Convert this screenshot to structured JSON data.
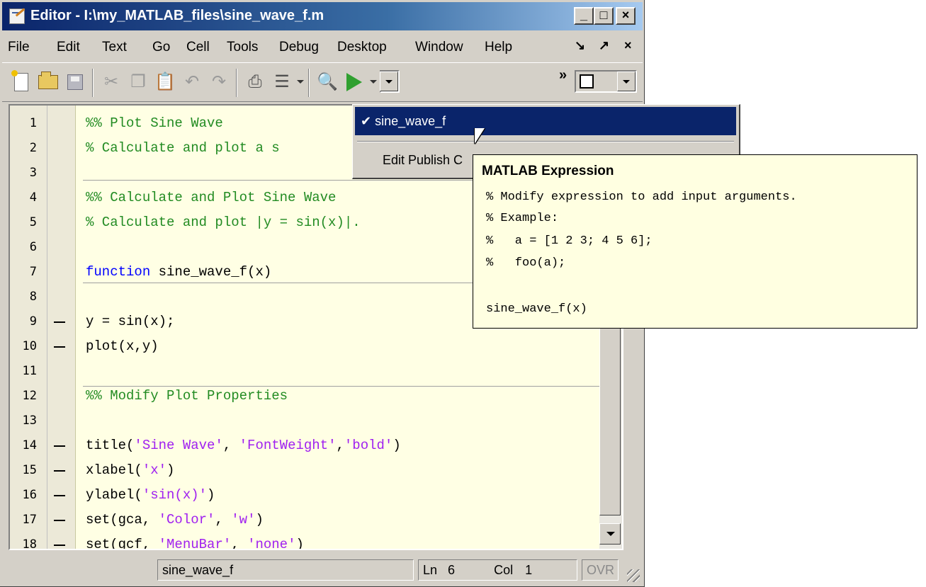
{
  "window": {
    "title": "Editor - I:\\my_MATLAB_files\\sine_wave_f.m",
    "minimize": "_",
    "maximize": "□",
    "close": "×"
  },
  "menu": {
    "items": [
      "File",
      "Edit",
      "Text",
      "Go",
      "Cell",
      "Tools",
      "Debug",
      "Desktop",
      "Window",
      "Help"
    ],
    "dock": "↘",
    "undock": "↗",
    "close": "×"
  },
  "toolbar": {
    "icons": [
      "new-file-icon",
      "open-folder-icon",
      "save-icon",
      "cut-icon",
      "copy-icon",
      "paste-icon",
      "undo-icon",
      "redo-icon",
      "print-icon",
      "publish-icon",
      "find-icon",
      "run-icon"
    ],
    "cut_glyph": "✂",
    "copy_glyph": "❐",
    "paste_glyph": "📋",
    "undo_glyph": "↶",
    "redo_glyph": "↷",
    "print_glyph": "⎙",
    "publish_glyph": "☰",
    "find_glyph": "🔍",
    "overflow": "»"
  },
  "editor": {
    "lines": [
      {
        "n": "1",
        "bp": false,
        "parts": [
          {
            "t": "%% Plot Sine Wave",
            "c": "com"
          }
        ]
      },
      {
        "n": "2",
        "bp": false,
        "parts": [
          {
            "t": "% Calculate and plot a s",
            "c": "com"
          }
        ]
      },
      {
        "n": "3",
        "bp": false,
        "parts": []
      },
      {
        "n": "4",
        "bp": false,
        "parts": [
          {
            "t": "%% Calculate and Plot Sine Wave",
            "c": "com"
          }
        ]
      },
      {
        "n": "5",
        "bp": false,
        "parts": [
          {
            "t": "% Calculate and plot |y = sin(x)|.",
            "c": "com"
          }
        ]
      },
      {
        "n": "6",
        "bp": false,
        "parts": []
      },
      {
        "n": "7",
        "bp": false,
        "parts": [
          {
            "t": "function",
            "c": "kw"
          },
          {
            "t": " sine_wave_f(x)",
            "c": "def"
          }
        ]
      },
      {
        "n": "8",
        "bp": false,
        "parts": []
      },
      {
        "n": "9",
        "bp": true,
        "parts": [
          {
            "t": "y = sin(x);",
            "c": "def"
          }
        ]
      },
      {
        "n": "10",
        "bp": true,
        "parts": [
          {
            "t": "plot(x,y)",
            "c": "def"
          }
        ]
      },
      {
        "n": "11",
        "bp": false,
        "parts": []
      },
      {
        "n": "12",
        "bp": false,
        "parts": [
          {
            "t": "%% Modify Plot Properties",
            "c": "com"
          }
        ]
      },
      {
        "n": "13",
        "bp": false,
        "parts": []
      },
      {
        "n": "14",
        "bp": true,
        "parts": [
          {
            "t": "title(",
            "c": "def"
          },
          {
            "t": "'Sine Wave'",
            "c": "str"
          },
          {
            "t": ", ",
            "c": "def"
          },
          {
            "t": "'FontWeight'",
            "c": "str"
          },
          {
            "t": ",",
            "c": "def"
          },
          {
            "t": "'bold'",
            "c": "str"
          },
          {
            "t": ")",
            "c": "def"
          }
        ]
      },
      {
        "n": "15",
        "bp": true,
        "parts": [
          {
            "t": "xlabel(",
            "c": "def"
          },
          {
            "t": "'x'",
            "c": "str"
          },
          {
            "t": ")",
            "c": "def"
          }
        ]
      },
      {
        "n": "16",
        "bp": true,
        "parts": [
          {
            "t": "ylabel(",
            "c": "def"
          },
          {
            "t": "'sin(x)'",
            "c": "str"
          },
          {
            "t": ")",
            "c": "def"
          }
        ]
      },
      {
        "n": "17",
        "bp": true,
        "parts": [
          {
            "t": "set(gca, ",
            "c": "def"
          },
          {
            "t": "'Color'",
            "c": "str"
          },
          {
            "t": ", ",
            "c": "def"
          },
          {
            "t": "'w'",
            "c": "str"
          },
          {
            "t": ")",
            "c": "def"
          }
        ]
      },
      {
        "n": "18",
        "bp": true,
        "parts": [
          {
            "t": "set(gcf, ",
            "c": "def"
          },
          {
            "t": "'MenuBar'",
            "c": "str"
          },
          {
            "t": ", ",
            "c": "def"
          },
          {
            "t": "'none'",
            "c": "str"
          },
          {
            "t": ")",
            "c": "def"
          }
        ]
      }
    ]
  },
  "dropdown": {
    "selected": "✔ sine_wave_f",
    "item2": "Edit Publish C"
  },
  "tooltip": {
    "title": "MATLAB Expression",
    "lines": [
      "% Modify expression to add input arguments.",
      "% Example:",
      "%   a = [1 2 3; 4 5 6];",
      "%   foo(a);",
      "",
      "sine_wave_f(x)"
    ]
  },
  "status": {
    "function_name": "sine_wave_f",
    "ln_label": "Ln",
    "ln_value": "6",
    "col_label": "Col",
    "col_value": "1",
    "ovr": "OVR"
  },
  "colors": {
    "comment": "#228b22",
    "keyword": "#0000ff",
    "string": "#a020f0",
    "code_bg": "#ffffe4",
    "selection": "#0a246a",
    "tooltip_bg": "#ffffe1"
  }
}
